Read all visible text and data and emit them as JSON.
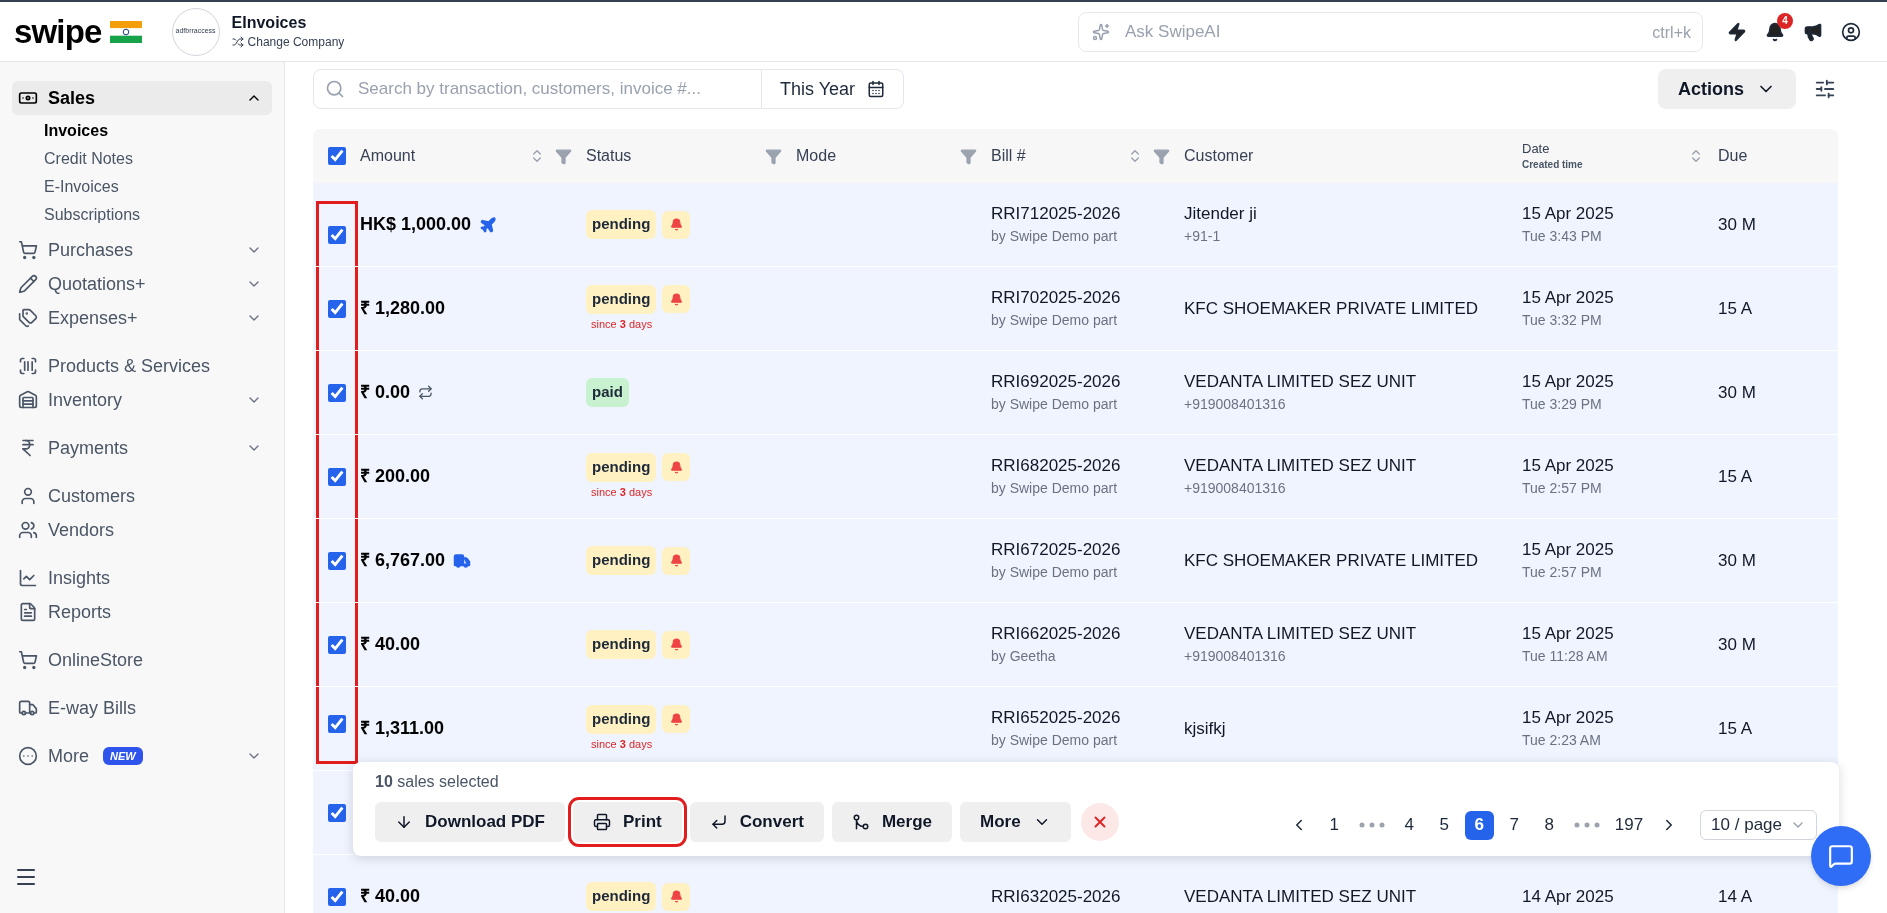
{
  "header": {
    "logo": "swipe",
    "company": {
      "avatar_text": "adfbrraccess",
      "name": "EInvoices",
      "switch_label": "Change Company"
    },
    "ai_search": {
      "placeholder": "Ask SwipeAI",
      "shortcut": "ctrl+k"
    },
    "notifications_count": "4"
  },
  "sidebar": {
    "sections": [
      [
        {
          "label": "Sales",
          "expanded": true,
          "selected": true,
          "children": [
            {
              "label": "Invoices",
              "selected": true
            },
            {
              "label": "Credit Notes",
              "selected": false
            },
            {
              "label": "E-Invoices",
              "selected": false
            },
            {
              "label": "Subscriptions",
              "selected": false
            }
          ]
        },
        {
          "label": "Purchases",
          "expanded": false,
          "selected": false
        },
        {
          "label": "Quotations+",
          "expanded": false,
          "selected": false
        },
        {
          "label": "Expenses+",
          "expanded": false,
          "selected": false
        }
      ],
      [
        {
          "label": "Products & Services",
          "selected": false
        },
        {
          "label": "Inventory",
          "expanded": false,
          "selected": false
        }
      ],
      [
        {
          "label": "Payments",
          "expanded": false,
          "selected": false
        }
      ],
      [
        {
          "label": "Customers",
          "selected": false
        },
        {
          "label": "Vendors",
          "selected": false
        }
      ],
      [
        {
          "label": "Insights",
          "selected": false
        },
        {
          "label": "Reports",
          "selected": false
        }
      ],
      [
        {
          "label": "OnlineStore",
          "selected": false
        }
      ],
      [
        {
          "label": "E-way Bills",
          "selected": false
        }
      ],
      [
        {
          "label": "More",
          "badge": "NEW",
          "expanded": false,
          "selected": false
        }
      ]
    ]
  },
  "toolbar": {
    "search": {
      "placeholder": "Search by transaction, customers, invoice #..."
    },
    "period": "This Year",
    "actions": "Actions"
  },
  "table": {
    "all_checked": true,
    "columns": [
      {
        "label": "Amount",
        "sortable": true,
        "filterable": true
      },
      {
        "label": "Status",
        "sortable": false,
        "filterable": true
      },
      {
        "label": "Mode",
        "sortable": false,
        "filterable": true
      },
      {
        "label": "Bill #",
        "sortable": true,
        "filterable": true
      },
      {
        "label": "Customer",
        "sortable": false,
        "filterable": false
      },
      {
        "label": "Date",
        "sublabel": "Created time",
        "sortable": true,
        "filterable": false
      },
      {
        "label": "Due",
        "sortable": false,
        "filterable": false
      }
    ],
    "rows": [
      {
        "checked": true,
        "highlighted": true,
        "kind": "international",
        "amount": "HK$ 1,000.00",
        "status": {
          "label": "pending",
          "kind": "pending",
          "reminder": true
        },
        "bill": "RRI712025-2026",
        "bill_by": "by Swipe Demo part",
        "customer": "Jitender ji",
        "phone": "+91-1",
        "date": "15 Apr 2025",
        "time": "Tue 3:43 PM",
        "due": "30 M"
      },
      {
        "checked": true,
        "highlighted": true,
        "kind": "standard",
        "amount": "₹ 1,280.00",
        "status": {
          "label": "pending",
          "kind": "pending",
          "reminder": true,
          "since": "since **3** days"
        },
        "bill": "RRI702025-2026",
        "bill_by": "by Swipe Demo part",
        "customer": "KFC SHOEMAKER PRIVATE LIMITED",
        "date": "15 Apr 2025",
        "time": "Tue 3:32 PM",
        "due": "15 A"
      },
      {
        "checked": true,
        "highlighted": true,
        "kind": "recurring",
        "amount": "₹ 0.00",
        "status": {
          "label": "paid",
          "kind": "paid",
          "reminder": false
        },
        "bill": "RRI692025-2026",
        "bill_by": "by Swipe Demo part",
        "customer": "VEDANTA LIMITED SEZ UNIT",
        "phone": "+919008401316",
        "date": "15 Apr 2025",
        "time": "Tue 3:29 PM",
        "due": "30 M"
      },
      {
        "checked": true,
        "highlighted": true,
        "kind": "standard",
        "amount": "₹ 200.00",
        "status": {
          "label": "pending",
          "kind": "pending",
          "reminder": true,
          "since": "since **3** days"
        },
        "bill": "RRI682025-2026",
        "bill_by": "by Swipe Demo part",
        "customer": "VEDANTA LIMITED SEZ UNIT",
        "phone": "+919008401316",
        "date": "15 Apr 2025",
        "time": "Tue 2:57 PM",
        "due": "15 A"
      },
      {
        "checked": true,
        "highlighted": true,
        "kind": "eway",
        "amount": "₹ 6,767.00",
        "status": {
          "label": "pending",
          "kind": "pending",
          "reminder": true
        },
        "bill": "RRI672025-2026",
        "bill_by": "by Swipe Demo part",
        "customer": "KFC SHOEMAKER PRIVATE LIMITED",
        "date": "15 Apr 2025",
        "time": "Tue 2:57 PM",
        "due": "30 M"
      },
      {
        "checked": true,
        "highlighted": true,
        "kind": "standard",
        "amount": "₹ 40.00",
        "status": {
          "label": "pending",
          "kind": "pending",
          "reminder": true
        },
        "bill": "RRI662025-2026",
        "bill_by": "by Geetha",
        "customer": "VEDANTA LIMITED SEZ UNIT",
        "phone": "+919008401316",
        "date": "15 Apr 2025",
        "time": "Tue 11:28 AM",
        "due": "30 M"
      },
      {
        "checked": true,
        "highlighted": true,
        "kind": "standard",
        "amount": "₹ 1,311.00",
        "status": {
          "label": "pending",
          "kind": "pending",
          "reminder": true,
          "since": "since **3** days"
        },
        "bill": "RRI652025-2026",
        "bill_by": "by Swipe Demo part",
        "customer": "kjsifkj",
        "date": "15 Apr 2025",
        "time": "Tue 2:23 AM",
        "due": "15 A"
      },
      {
        "checked": true,
        "highlighted": false,
        "kind": "hidden"
      },
      {
        "checked": true,
        "highlighted": false,
        "kind": "standard",
        "amount": "₹ 40.00",
        "status": {
          "label": "pending",
          "kind": "pending",
          "reminder": true
        },
        "bill": "RRI632025-2026",
        "customer": "VEDANTA LIMITED SEZ UNIT",
        "date": "14 Apr 2025",
        "due": "14 A"
      }
    ]
  },
  "selection_bar": {
    "summary": "**10** sales selected",
    "actions": [
      {
        "label": "Download PDF",
        "kind": "download",
        "highlighted": false
      },
      {
        "label": "Print",
        "kind": "print",
        "highlighted": true
      },
      {
        "label": "Convert",
        "kind": "convert",
        "highlighted": false
      },
      {
        "label": "Merge",
        "kind": "merge",
        "highlighted": false
      },
      {
        "label": "More",
        "kind": "more",
        "highlighted": false
      }
    ],
    "pages": [
      {
        "kind": "prev"
      },
      {
        "kind": "page",
        "label": "1",
        "selected": false
      },
      {
        "kind": "ellipsis"
      },
      {
        "kind": "page",
        "label": "4",
        "selected": false
      },
      {
        "kind": "page",
        "label": "5",
        "selected": false
      },
      {
        "kind": "page",
        "label": "6",
        "selected": true
      },
      {
        "kind": "page",
        "label": "7",
        "selected": false
      },
      {
        "kind": "page",
        "label": "8",
        "selected": false
      },
      {
        "kind": "ellipsis"
      },
      {
        "kind": "page",
        "label": "197",
        "selected": false
      },
      {
        "kind": "next"
      }
    ],
    "page_size": "10 / page"
  }
}
